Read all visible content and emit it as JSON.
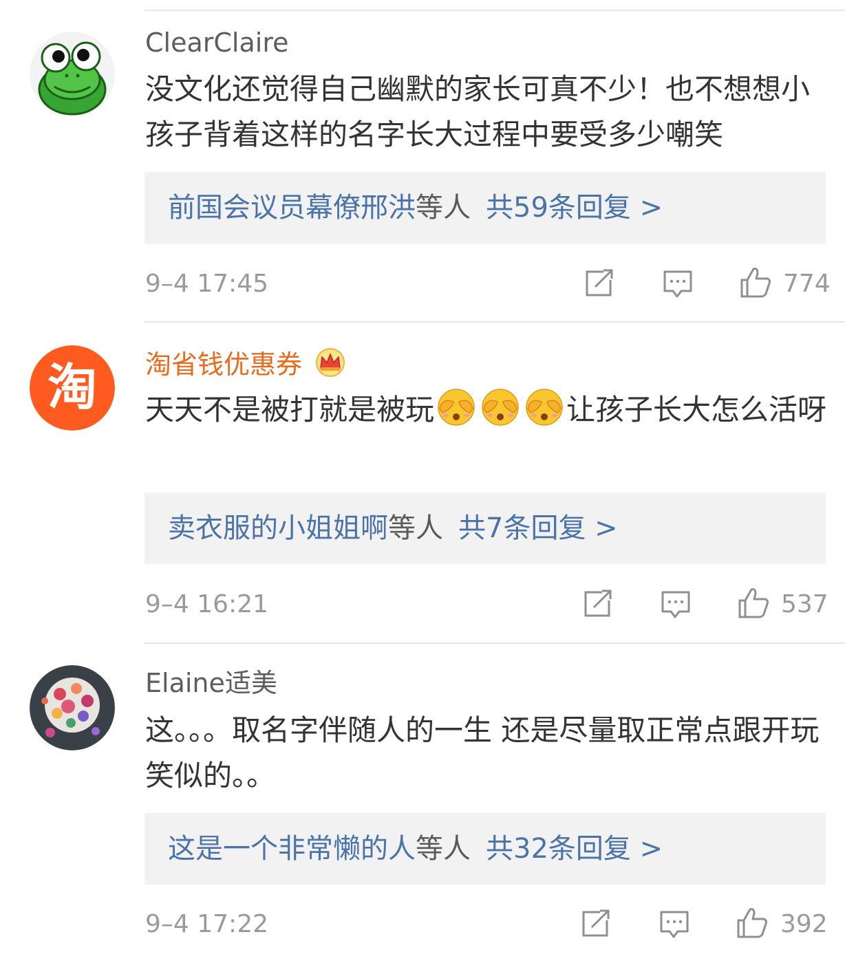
{
  "comments": [
    {
      "username": "ClearClaire",
      "avatar": "frog-avatar",
      "text": "没文化还觉得自己幽默的家长可真不少！也不想想小孩子背着这样的名字长大过程中要受多少嘲笑",
      "reply_name": "前国会议员幕僚邢洪",
      "reply_suffix": "等人",
      "reply_count": "共59条回复 >",
      "time": "9–4 17:45",
      "likes": "774"
    },
    {
      "username": "淘省钱优惠券",
      "avatar": "taobao-avatar",
      "badge": "crown-badge-icon",
      "text_before": "天天不是被打就是被玩",
      "emoji": "face-covering-eyes-emoji",
      "text_after": "让孩子长大怎么活呀",
      "reply_name": "卖衣服的小姐姐啊",
      "reply_suffix": "等人",
      "reply_count": "共7条回复 >",
      "time": "9–4 16:21",
      "likes": "537"
    },
    {
      "username": "Elaine适美",
      "avatar": "flower-cake-avatar",
      "text": "这。。。取名字伴随人的一生 还是尽量取正常点跟开玩笑似的。。",
      "reply_name": "这是一个非常懒的人",
      "reply_suffix": "等人",
      "reply_count": "共32条回复 >",
      "time": "9–4 17:22",
      "likes": "392"
    }
  ],
  "colors": {
    "link_blue": "#4a74a8",
    "vip_orange": "#e86b1e",
    "meta_gray": "#9a9a9a",
    "reply_bg": "#f2f2f2"
  },
  "icons": [
    "repost-icon",
    "comment-icon",
    "thumbs-up-icon"
  ]
}
